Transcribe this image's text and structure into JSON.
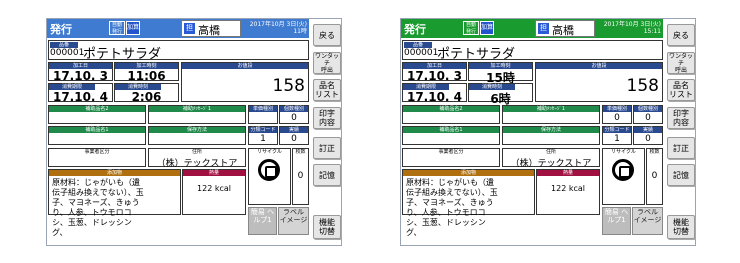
{
  "screens": [
    {
      "header": {
        "mode": "発行",
        "flag_auto": "自動\n発行",
        "flag_add": "加算",
        "operator_icon": "担",
        "operator_name": "高橋",
        "datetime": "2017年10月 3日(火)\n11時 "
      },
      "plu": {
        "tag": "品番",
        "code": "000001",
        "name": "ポテトサラダ"
      },
      "processing_date": {
        "label": "加工日",
        "value": "17.10. 3"
      },
      "processing_time": {
        "label": "加工時刻",
        "value": "11:06"
      },
      "expiry_date": {
        "label": "消費期限",
        "value": "17.10. 4"
      },
      "expiry_time": {
        "label": "消費時刻",
        "value": "2:06"
      },
      "price": {
        "label": "お値段",
        "value": "158"
      },
      "aux_name2": {
        "label": "補助品名2",
        "value": ""
      },
      "aux_message1": {
        "label": "補助ﾒｯｾｰｼﾞ1",
        "value": ""
      },
      "unit_type": {
        "label": "単価種別",
        "value": ""
      },
      "count_type": {
        "label": "個数種別",
        "value": "0"
      },
      "aux_name1": {
        "label": "補助品名1",
        "value": ""
      },
      "storage_method": {
        "label": "保存方法",
        "value": ""
      },
      "class_code": {
        "label": "分類コード",
        "value": "1"
      },
      "discount": {
        "label": "実績",
        "value": "0"
      },
      "business_class": {
        "label": "事業者区分",
        "value": ""
      },
      "address": {
        "label": "住所",
        "value": "（株）テックストア"
      },
      "recycle": {
        "label": "リサイクル"
      },
      "quantity": {
        "label": "枚数",
        "value": "0"
      },
      "additives": {
        "label": "添加物",
        "value": "原材料：じゃがいも（遺伝子組み換えでない）、玉子、マヨネーズ、きゅうり、人参、トウモロコシ、玉葱、ドレッシング、"
      },
      "calories": {
        "label": "熱量",
        "value": "122 kcal"
      },
      "help_button": "簡易\nヘルプ1",
      "image_button": "ラベル\nイメージ",
      "side": {
        "back": "戻る",
        "onetouch": "ワンタッチ\n呼出",
        "plu_list": "品名\nリスト",
        "print_content": "印字\n内容",
        "correct": "訂正",
        "memory": "記憶",
        "function_switch": "機能\n切替"
      }
    },
    {
      "header": {
        "mode": "発行",
        "flag_auto": "自動\n発行",
        "flag_add": "加算",
        "operator_icon": "担",
        "operator_name": "高橋",
        "datetime": "2017年10月 3日(火)\n15:11"
      },
      "plu": {
        "tag": "品番",
        "code": "000001",
        "name": "ポテトサラダ"
      },
      "processing_date": {
        "label": "加工日",
        "value": "17.10. 3"
      },
      "processing_time": {
        "label": "加工時刻",
        "value": "15時"
      },
      "expiry_date": {
        "label": "消費期限",
        "value": "17.10. 4"
      },
      "expiry_time": {
        "label": "消費時刻",
        "value": "6時"
      },
      "price": {
        "label": "お値段",
        "value": "158"
      },
      "aux_name2": {
        "label": "補助品名2",
        "value": ""
      },
      "aux_message1": {
        "label": "補助ﾒｯｾｰｼﾞ1",
        "value": ""
      },
      "unit_type": {
        "label": "単価種別",
        "value": "0"
      },
      "count_type": {
        "label": "個数種別",
        "value": "0"
      },
      "aux_name1": {
        "label": "補助品名1",
        "value": ""
      },
      "storage_method": {
        "label": "保存方法",
        "value": ""
      },
      "class_code": {
        "label": "分類コード",
        "value": "1"
      },
      "discount": {
        "label": "実績",
        "value": "0"
      },
      "business_class": {
        "label": "事業者区分",
        "value": ""
      },
      "address": {
        "label": "住所",
        "value": "（株）テックストア"
      },
      "recycle": {
        "label": "リサイクル"
      },
      "quantity": {
        "label": "枚数",
        "value": "0"
      },
      "additives": {
        "label": "添加物",
        "value": "原材料：じゃがいも（遺伝子組み換えでない）、玉子、マヨネーズ、きゅうり、人参、トウモロコシ、玉葱、ドレッシング、"
      },
      "calories": {
        "label": "熱量",
        "value": "122 kcal"
      },
      "help_button": "簡易\nヘルプ1",
      "image_button": "ラベル\nイメージ",
      "side": {
        "back": "戻る",
        "onetouch": "ワンタッチ\n呼出",
        "plu_list": "品名\nリスト",
        "print_content": "印字\n内容",
        "correct": "訂正",
        "memory": "記憶",
        "function_switch": "機能\n切替"
      }
    }
  ],
  "colors": {
    "left_titlebar": "#3f7bd0",
    "right_titlebar": "#1a9b2f",
    "header_blue": "#2a4a90",
    "header_green": "#1f8a4a",
    "additives_header": "#b07010",
    "calories_header": "#a01040"
  },
  "icons": {
    "operator": "person-badge-icon",
    "recycle": "pla-recycle-icon"
  }
}
